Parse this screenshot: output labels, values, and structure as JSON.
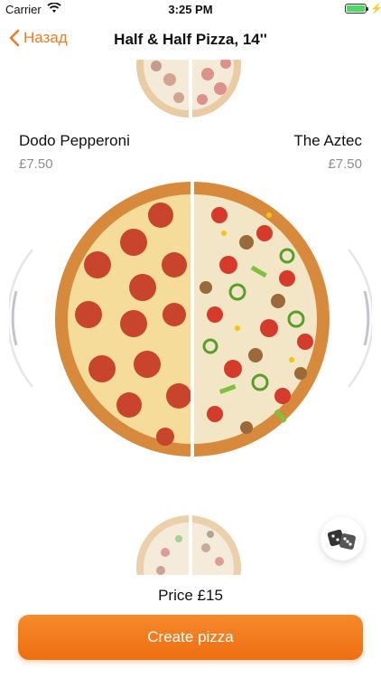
{
  "status_bar": {
    "carrier": "Carrier",
    "time": "3:25 PM"
  },
  "nav": {
    "back_label": "Назад",
    "title": "Half & Half Pizza, 14''"
  },
  "left_half": {
    "name": "Dodo Pepperoni",
    "price": "£7.50"
  },
  "right_half": {
    "name": "The Aztec",
    "price": "£7.50"
  },
  "total": "Price £15",
  "create_button": "Create pizza",
  "colors": {
    "accent": "#f07c1f",
    "button": "#ef7419",
    "price_gray": "#8e8e93"
  },
  "icons": [
    "wifi-icon",
    "battery-icon",
    "back-chevron-icon",
    "dice-icon"
  ]
}
